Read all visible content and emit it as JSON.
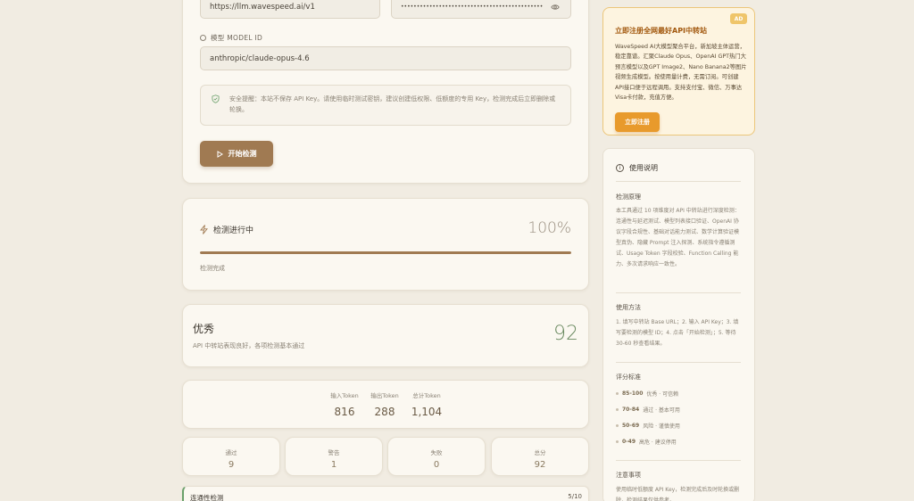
{
  "form": {
    "base_url_value": "https://llm.wavespeed.ai/v1",
    "api_key_value": "••••••••••••••••••••••••••••••••••••••••••••••••••••",
    "model_label": "模型 MODEL ID",
    "model_value": "anthropic/claude-opus-4.6",
    "security_notice": "安全提醒：本站不保存 API Key。请使用临时测试密钥，建议创建低权限、低额度的专用 Key，检测完成后立即删除或轮换。",
    "start_button": "开始检测"
  },
  "progress": {
    "title": "检测进行中",
    "percent_text": "100%",
    "percent_value": 100,
    "status": "检测完成"
  },
  "result": {
    "grade": "优秀",
    "description": "API 中转站表现良好，各项检测基本通过",
    "score": "92"
  },
  "tokens": [
    {
      "label": "输入Token",
      "value": "816"
    },
    {
      "label": "输出Token",
      "value": "288"
    },
    {
      "label": "总计Token",
      "value": "1,104"
    }
  ],
  "summary": [
    {
      "label": "通过",
      "value": "9"
    },
    {
      "label": "警告",
      "value": "1"
    },
    {
      "label": "失败",
      "value": "0"
    },
    {
      "label": "总分",
      "value": "92"
    }
  ],
  "check_row": {
    "label": "连通性检测",
    "count": "5/10"
  },
  "ad": {
    "title": "立即注册全网最好API中转站",
    "badge": "AD",
    "text": "WaveSpeed AI大模型聚合平台，新加坡主体运营，稳定靠谱。汇聚Claude Opus、OpenAI GPT热门大预言模型以及GPT Image2、Nano Banana2等图片视频生成模型。按使用量计费，无需订阅。可创建API接口便于远程调用。支持支付宝、微信、万事达Visa卡付款，充值方便。",
    "button": "立即注册",
    "accent": "#e89a2c"
  },
  "help": {
    "title": "使用说明",
    "principle_title": "检测原理",
    "principle_text": "本工具通过 10 项维度对 API 中转站进行深度检测：连通性与延迟测试、模型列表接口验证、OpenAI 协议字段合规性、基础对话能力测试、数学计算验证模型真伪、隐藏 Prompt 注入探测、系统指令遵循测试、Usage Token 字段校验、Function Calling 能力、多次请求响应一致性。",
    "usage_title": "使用方法",
    "usage_text": "1. 填写中转站 Base URL；2. 输入 API Key；3. 填写要检测的模型 ID；4. 点击「开始检测」；5. 等待 30-60 秒查看结果。",
    "scoring_title": "评分标准",
    "scoring": [
      {
        "range": "85-100",
        "desc": "优秀 · 可信赖"
      },
      {
        "range": "70-84",
        "desc": "通过 · 基本可用"
      },
      {
        "range": "50-69",
        "desc": "风险 · 谨慎使用"
      },
      {
        "range": "0-49",
        "desc": "高危 · 建议停用"
      }
    ],
    "notes_title": "注意事项",
    "notes_text": "使用临时低额度 API Key，检测完成后及时轮换或删除，检测结果仅供参考。"
  }
}
